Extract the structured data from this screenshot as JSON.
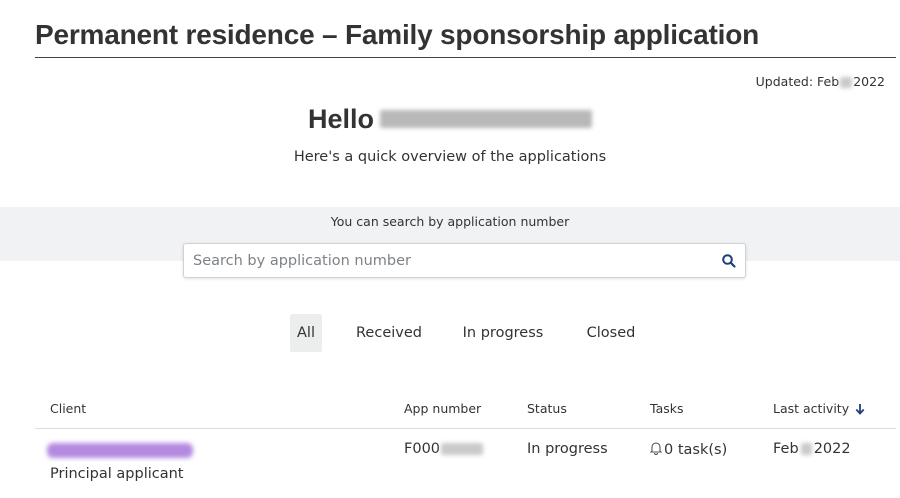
{
  "header": {
    "title": "Permanent residence – Family sponsorship application",
    "updated_prefix": "Updated: Feb",
    "updated_year": "2022"
  },
  "greeting": {
    "hello": "Hello",
    "subtitle": "Here's a quick overview of the applications"
  },
  "search": {
    "hint": "You can search by application number",
    "placeholder": "Search by application number",
    "icon": "search-icon"
  },
  "tabs": [
    {
      "label": "All",
      "active": true
    },
    {
      "label": "Received",
      "active": false
    },
    {
      "label": "In progress",
      "active": false
    },
    {
      "label": "Closed",
      "active": false
    }
  ],
  "table": {
    "columns": [
      "Client",
      "App number",
      "Status",
      "Tasks",
      "Last activity"
    ],
    "sort_indicator": "arrow-down-icon",
    "rows": [
      {
        "client_role": "Principal applicant",
        "app_number_prefix": "F000",
        "status": "In progress",
        "tasks": "0 task(s)",
        "last_activity_month": "Feb",
        "last_activity_year": "2022"
      }
    ]
  },
  "colors": {
    "accent": "#1f3f7a",
    "search_band": "#f1f2f3",
    "active_tab": "#eceded"
  }
}
